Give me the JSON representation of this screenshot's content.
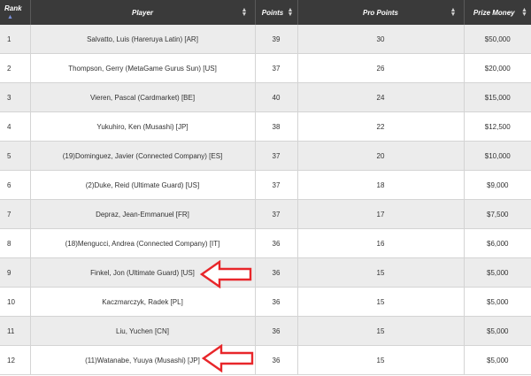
{
  "table": {
    "headers": {
      "rank": "Rank",
      "player": "Player",
      "points": "Points",
      "pro_points": "Pro Points",
      "prize_money": "Prize Money"
    },
    "rows": [
      {
        "rank": "1",
        "player": "Salvatto, Luis (Hareruya Latin) [AR]",
        "points": "39",
        "pro_points": "30",
        "prize_money": "$50,000"
      },
      {
        "rank": "2",
        "player": "Thompson, Gerry (MetaGame Gurus Sun) [US]",
        "points": "37",
        "pro_points": "26",
        "prize_money": "$20,000"
      },
      {
        "rank": "3",
        "player": "Vieren, Pascal (Cardmarket) [BE]",
        "points": "40",
        "pro_points": "24",
        "prize_money": "$15,000"
      },
      {
        "rank": "4",
        "player": "Yukuhiro, Ken (Musashi) [JP]",
        "points": "38",
        "pro_points": "22",
        "prize_money": "$12,500"
      },
      {
        "rank": "5",
        "player": "(19)Dominguez, Javier (Connected Company) [ES]",
        "points": "37",
        "pro_points": "20",
        "prize_money": "$10,000"
      },
      {
        "rank": "6",
        "player": "(2)Duke, Reid (Ultimate Guard) [US]",
        "points": "37",
        "pro_points": "18",
        "prize_money": "$9,000"
      },
      {
        "rank": "7",
        "player": "Depraz, Jean-Emmanuel [FR]",
        "points": "37",
        "pro_points": "17",
        "prize_money": "$7,500"
      },
      {
        "rank": "8",
        "player": "(18)Mengucci, Andrea (Connected Company) [IT]",
        "points": "36",
        "pro_points": "16",
        "prize_money": "$6,000"
      },
      {
        "rank": "9",
        "player": "Finkel, Jon (Ultimate Guard) [US]",
        "points": "36",
        "pro_points": "15",
        "prize_money": "$5,000"
      },
      {
        "rank": "10",
        "player": "Kaczmarczyk, Radek [PL]",
        "points": "36",
        "pro_points": "15",
        "prize_money": "$5,000"
      },
      {
        "rank": "11",
        "player": "Liu, Yuchen [CN]",
        "points": "36",
        "pro_points": "15",
        "prize_money": "$5,000"
      },
      {
        "rank": "12",
        "player": "(11)Watanabe, Yuuya (Musashi) [JP]",
        "points": "36",
        "pro_points": "15",
        "prize_money": "$5,000"
      }
    ]
  },
  "icons": {
    "sort": "sort-arrows-icon",
    "sort_asc": "sort-ascending-icon",
    "highlight": "red-outline-arrow-icon"
  },
  "colors": {
    "header_bg": "#3a3a3a",
    "row_alt_bg": "#ececec",
    "arrow": "#e8262a"
  }
}
